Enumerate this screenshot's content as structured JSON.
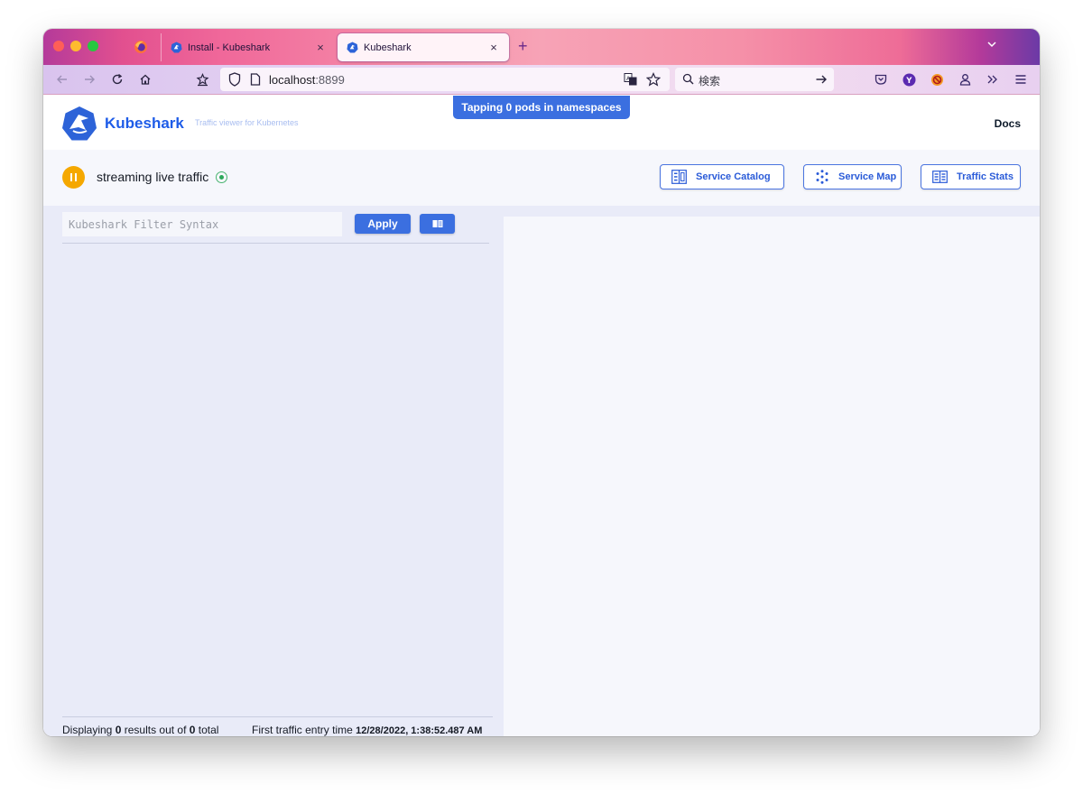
{
  "browser": {
    "tabs": [
      {
        "title": "Install - Kubeshark",
        "active": false
      },
      {
        "title": "Kubeshark",
        "active": true
      }
    ],
    "close_glyph": "×",
    "newtab_glyph": "+",
    "url": {
      "host": "localhost",
      "port": ":8899"
    },
    "search_placeholder": "検索"
  },
  "header": {
    "brand": "Kubeshark",
    "tagline": "Traffic viewer for Kubernetes",
    "docs_link": "Docs",
    "tapping_badge": "Tapping 0 pods in namespaces"
  },
  "controls": {
    "streaming_label": "streaming live traffic",
    "buttons": {
      "service_catalog": "Service Catalog",
      "service_map": "Service Map",
      "traffic_stats": "Traffic Stats"
    }
  },
  "filter": {
    "placeholder": "Kubeshark Filter Syntax",
    "apply_label": "Apply"
  },
  "footer": {
    "displaying_prefix": "Displaying ",
    "results_count": "0",
    "results_mid": " results out of ",
    "total_count": "0",
    "total_suffix": " total",
    "first_entry_label": "First traffic entry time ",
    "first_entry_time": "12/28/2022, 1:38:52.487 AM"
  },
  "colors": {
    "accent": "#3b6fe0",
    "pause": "#f5a800",
    "live": "#2ea85a"
  },
  "icons": [
    "firefox-icon",
    "kubeshark-favicon",
    "back-icon",
    "forward-icon",
    "reload-icon",
    "home-icon",
    "extension-icon",
    "shield-icon",
    "page-icon",
    "translate-icon",
    "bookmark-star-icon",
    "search-icon",
    "go-arrow-icon",
    "pocket-icon",
    "yahoo-icon",
    "blocker-icon",
    "account-icon",
    "overflow-icon",
    "menu-icon",
    "pause-icon",
    "live-indicator-icon",
    "service-catalog-icon",
    "service-map-icon",
    "traffic-stats-icon",
    "book-icon"
  ]
}
